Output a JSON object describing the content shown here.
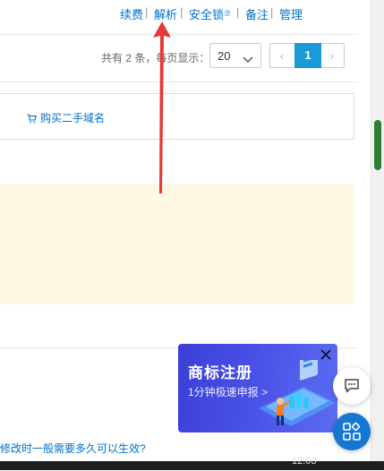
{
  "actions": {
    "renew": "续费",
    "dns": "解析",
    "security_lock": "安全锁",
    "security_help": "⑦",
    "filing": "备注",
    "manage": "管理",
    "separator": "|"
  },
  "pagination": {
    "count_prefix": "共有 2 条，",
    "count_suffix": "每页显示：",
    "page_size": "20",
    "prev": "‹",
    "current_page": "1",
    "next": "›"
  },
  "buy_domain": {
    "label": "购买二手域名"
  },
  "faq": {
    "text": "修改时一般需要多久可以生效?"
  },
  "ad": {
    "title": "商标注册",
    "subtitle": "1分钟极速申报 >"
  },
  "taskbar": {
    "clock": "12:03"
  },
  "colors": {
    "link": "#0070cc",
    "pager_active": "#1a9bd8",
    "notice_bg": "#fff8e4",
    "ad_bg": "#4950e6",
    "float_button": "#1677d2",
    "annotation_arrow": "#e53935",
    "scroll_thumb": "#2e7d32"
  },
  "icons": {
    "cart": "shopping-cart-icon",
    "chevron": "chevron-down-icon",
    "close": "close-icon",
    "chat": "chat-bubble-icon",
    "grid": "app-grid-icon"
  }
}
